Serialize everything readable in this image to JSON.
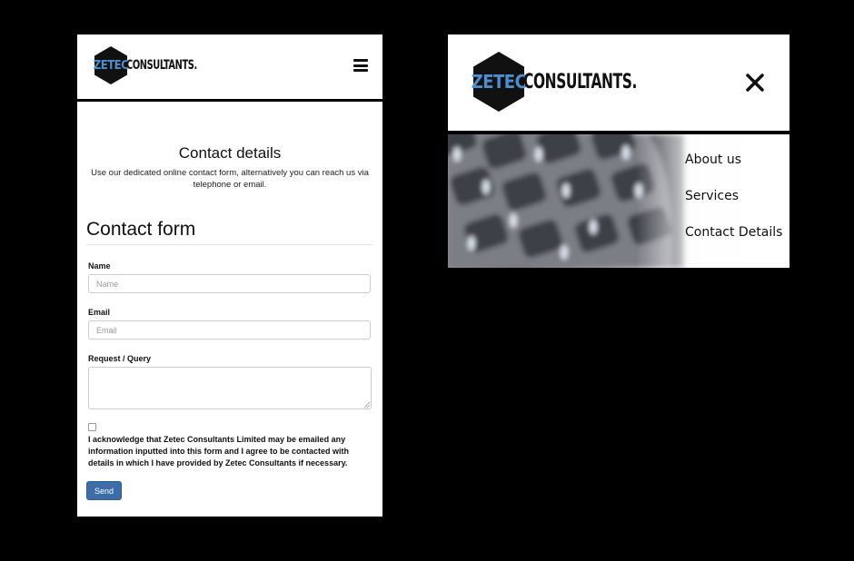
{
  "brand": {
    "hex_text": "ZETEC",
    "word_text": "CONSULTANTS.",
    "accent_color": "#4a8fd0",
    "hex_color": "#111111"
  },
  "mobile_form": {
    "menu_icon": "hamburger-menu-icon",
    "contact_title": "Contact details",
    "contact_subtitle": "Use our dedicated online contact form, alternatively you can reach us via telephone or email.",
    "form_heading": "Contact form",
    "fields": {
      "name": {
        "label": "Name",
        "placeholder": "Name"
      },
      "email": {
        "label": "Email",
        "placeholder": "Email"
      },
      "query": {
        "label": "Request / Query"
      }
    },
    "acknowledgement": "I acknowledge that Zetec Consultants Limited may be emailed any information inputted into this form and I agree to be contacted with details in which I have provided by Zetec Consultants if necessary.",
    "send_label": "Send",
    "send_color": "#3b6ea9"
  },
  "mobile_menu": {
    "close_icon": "close-icon",
    "items": [
      {
        "label": "About us"
      },
      {
        "label": "Services"
      },
      {
        "label": "Contact Details"
      }
    ]
  }
}
